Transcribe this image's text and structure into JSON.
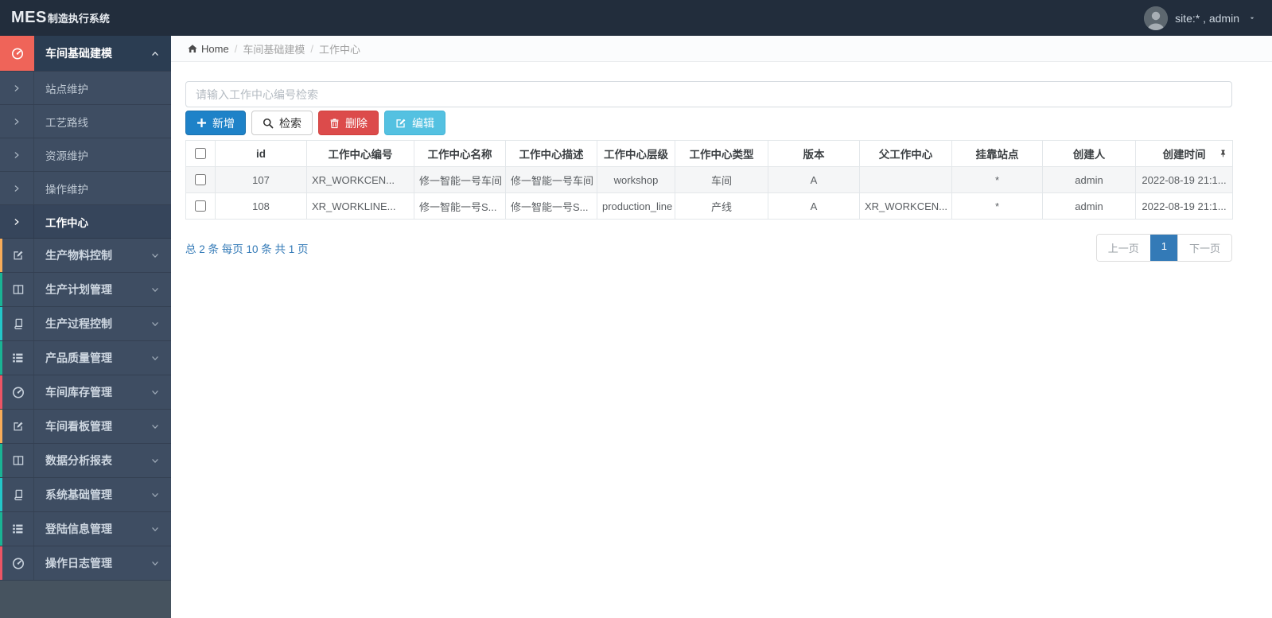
{
  "topbar": {
    "logo_primary": "MES",
    "logo_secondary": "制造执行系统",
    "user_label": "site:* , admin"
  },
  "breadcrumb": {
    "home": "Home",
    "items": [
      "车间基础建模",
      "工作中心"
    ]
  },
  "sidebar": {
    "parent": {
      "label": "车间基础建模",
      "icon": "dashboard-icon",
      "accent": "#ef6459"
    },
    "submenu": [
      {
        "label": "站点维护",
        "active": false
      },
      {
        "label": "工艺路线",
        "active": false
      },
      {
        "label": "资源维护",
        "active": false
      },
      {
        "label": "操作维护",
        "active": false
      },
      {
        "label": "工作中心",
        "active": true
      }
    ],
    "items": [
      {
        "label": "生产物料控制",
        "icon": "edit-icon",
        "accent": "#f8ac59"
      },
      {
        "label": "生产计划管理",
        "icon": "columns-icon",
        "accent": "#1ab394"
      },
      {
        "label": "生产过程控制",
        "icon": "book-icon",
        "accent": "#23c6c8"
      },
      {
        "label": "产品质量管理",
        "icon": "list-icon",
        "accent": "#1ab394"
      },
      {
        "label": "车间库存管理",
        "icon": "dashboard-icon",
        "accent": "#ed5565"
      },
      {
        "label": "车间看板管理",
        "icon": "edit-icon",
        "accent": "#f8ac59"
      },
      {
        "label": "数据分析报表",
        "icon": "columns-icon",
        "accent": "#1ab394"
      },
      {
        "label": "系统基础管理",
        "icon": "book-icon",
        "accent": "#23c6c8"
      },
      {
        "label": "登陆信息管理",
        "icon": "list-icon",
        "accent": "#1ab394"
      },
      {
        "label": "操作日志管理",
        "icon": "dashboard-icon",
        "accent": "#ed5565"
      }
    ]
  },
  "toolbar": {
    "search_placeholder": "请输入工作中心编号检索",
    "buttons": [
      {
        "label": "新增",
        "icon": "plus-icon",
        "variant": "primary",
        "color": "#1e82c8"
      },
      {
        "label": "检索",
        "icon": "search-icon",
        "variant": "default",
        "color": "#ffffff"
      },
      {
        "label": "删除",
        "icon": "trash-icon",
        "variant": "danger",
        "color": "#dc4b4b"
      },
      {
        "label": "编辑",
        "icon": "edit-icon",
        "variant": "info",
        "color": "#54c1e1"
      }
    ]
  },
  "table": {
    "columns": [
      "id",
      "工作中心编号",
      "工作中心名称",
      "工作中心描述",
      "工作中心层级",
      "工作中心类型",
      "版本",
      "父工作中心",
      "挂靠站点",
      "创建人",
      "创建时间"
    ],
    "rows": [
      [
        "107",
        "XR_WORKCEN...",
        "修一智能一号车间",
        "修一智能一号车间",
        "workshop",
        "车间",
        "A",
        "",
        "*",
        "admin",
        "2022-08-19 21:1..."
      ],
      [
        "108",
        "XR_WORKLINE...",
        "修一智能一号S...",
        "修一智能一号S...",
        "production_line",
        "产线",
        "A",
        "XR_WORKCEN...",
        "*",
        "admin",
        "2022-08-19 21:1..."
      ]
    ]
  },
  "pagination": {
    "summary": "总 2 条 每页 10 条 共 1 页",
    "prev_label": "上一页",
    "page_label": "1",
    "next_label": "下一页"
  },
  "colors": {
    "topbar_bg": "#222d3c",
    "sidebar_bg": "#46535f",
    "menu_item_bg": "#3e4d62",
    "active_parent_bg": "#2b3d52",
    "active_icon_bg": "#ef6459",
    "primary": "#1e82c8",
    "danger": "#dc4b4b",
    "info": "#54c1e1",
    "link_blue": "#337ab7",
    "pager_active": "#337ab7"
  }
}
